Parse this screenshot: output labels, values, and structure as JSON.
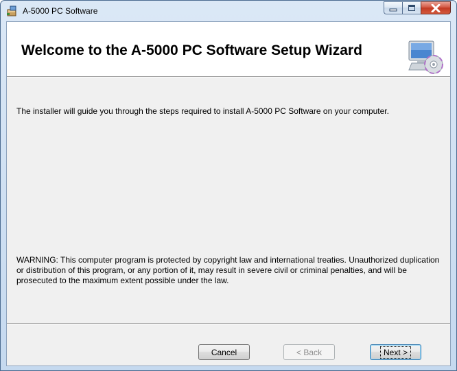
{
  "window": {
    "title": "A-5000 PC Software",
    "caption_icons": [
      "minimize-icon",
      "maximize-icon",
      "close-icon"
    ]
  },
  "banner": {
    "title": "Welcome to the A-5000 PC Software Setup Wizard",
    "icon": "computer-cd-icon"
  },
  "content": {
    "intro": "The installer will guide you through the steps required to install A-5000 PC Software on your computer.",
    "warning": "WARNING: This computer program is protected by copyright law and international treaties. Unauthorized duplication or distribution of this program, or any portion of it, may result in severe civil or criminal penalties, and will be prosecuted to the maximum extent possible under the law."
  },
  "buttons": {
    "cancel": "Cancel",
    "back": "< Back",
    "next": "Next >"
  },
  "colors": {
    "close_button": "#c23a24",
    "client_background": "#f0f0f0",
    "banner_background": "#ffffff"
  }
}
